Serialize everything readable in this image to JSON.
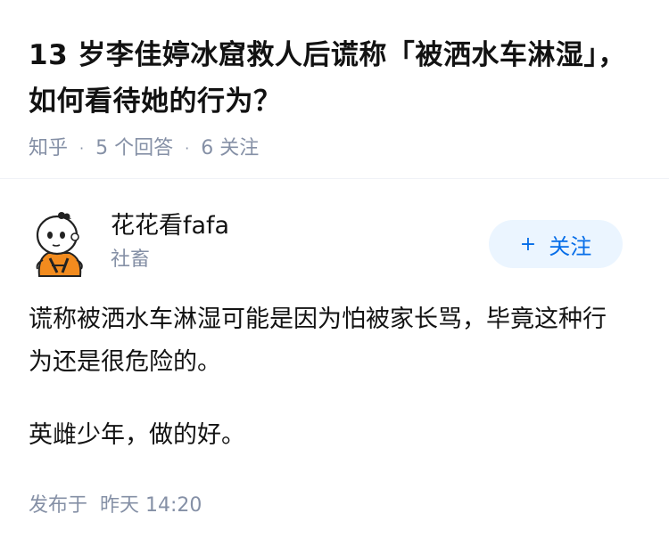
{
  "question": {
    "title": "13 岁李佳婷冰窟救人后谎称「被洒水车淋湿」，如何看待她的行为？",
    "source": "知乎",
    "answers_count": "5 个回答",
    "followers_count": "6 关注"
  },
  "answer": {
    "author": {
      "name": "花花看fafa",
      "headline": "社畜",
      "avatar_icon": "cartoon-avatar-icon"
    },
    "follow_button": {
      "icon": "plus-icon",
      "label": "关注"
    },
    "paragraphs": [
      "谎称被洒水车淋湿可能是因为怕被家长骂，毕竟这种行为还是很危险的。",
      "英雌少年，做的好。"
    ],
    "published_label": "发布于",
    "published_time": "昨天 14:20"
  },
  "colors": {
    "text": "#121212",
    "meta": "#8590a6",
    "accent": "#056de8",
    "button_bg": "#ebf5ff"
  }
}
